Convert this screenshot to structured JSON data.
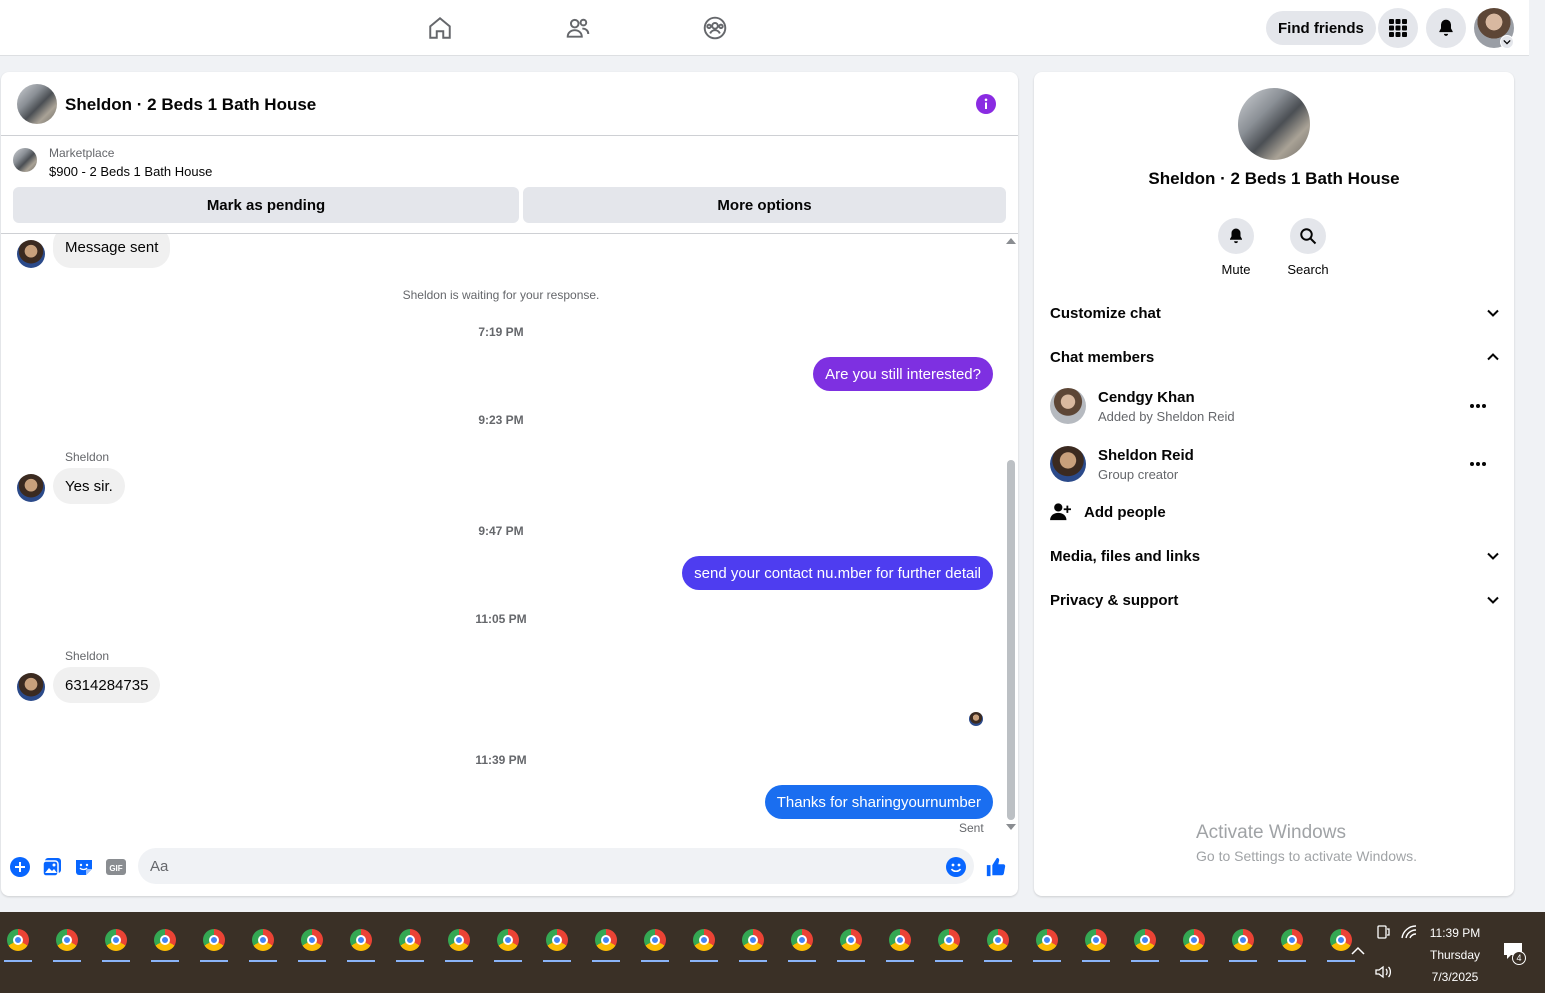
{
  "topbar": {
    "find_friends": "Find friends",
    "icons": [
      "home-icon",
      "friends-icon",
      "groups-icon",
      "menu-grid-icon",
      "notifications-bell-icon"
    ]
  },
  "chat": {
    "title": "Sheldon · 2 Beds 1 Bath House",
    "marketplace_label": "Marketplace",
    "listing": "$900 - 2 Beds 1 Bath House",
    "mark_pending": "Mark as pending",
    "more_options": "More options",
    "messages": {
      "m1": "Message sent",
      "waiting": "Sheldon is waiting for your response.",
      "t1": "7:19 PM",
      "m2": "Are you still interested?",
      "t2": "9:23 PM",
      "sender1": "Sheldon",
      "m3": "Yes sir.",
      "t3": "9:47 PM",
      "m4": "send your contact nu.mber for further detail",
      "t4": "11:05 PM",
      "sender2": "Sheldon",
      "m5": "6314284735",
      "t5": "11:39 PM",
      "m6": "Thanks for sharingyournumber",
      "sent": "Sent"
    },
    "composer_placeholder": "Aa"
  },
  "side": {
    "title": "Sheldon · 2 Beds 1 Bath House",
    "mute": "Mute",
    "search": "Search",
    "customize": "Customize chat",
    "members_header": "Chat members",
    "members": [
      {
        "name": "Cendgy Khan",
        "sub": "Added by Sheldon Reid"
      },
      {
        "name": "Sheldon Reid",
        "sub": "Group creator"
      }
    ],
    "add_people": "Add people",
    "media": "Media, files and links",
    "privacy": "Privacy & support"
  },
  "watermark": {
    "line1": "Activate Windows",
    "line2": "Go to Settings to activate Windows."
  },
  "taskbar": {
    "time": "11:39 PM",
    "day": "Thursday",
    "date": "7/3/2025",
    "notification_count": "4"
  },
  "colors": {
    "accent_purple": "#8a2be2",
    "bubble_purple": "#7e30e1",
    "bubble_indigo": "#4e3df0",
    "bubble_blue": "#1a6ef0",
    "like_blue": "#0866ff"
  }
}
